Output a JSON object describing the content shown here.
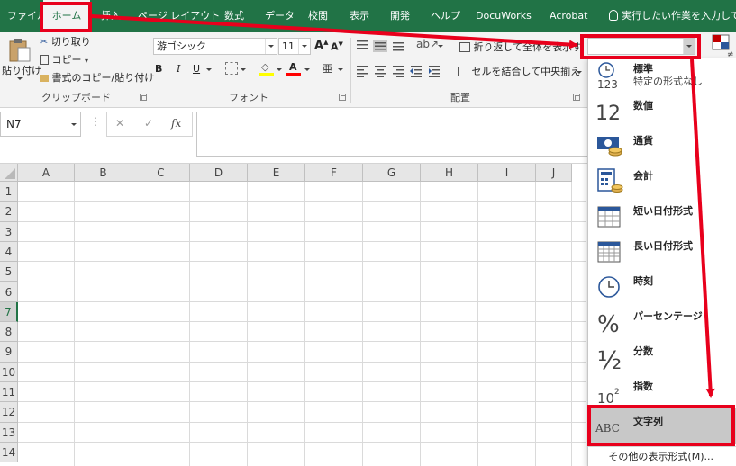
{
  "ribbon_tabs": [
    "ファイル",
    "ホーム",
    "挿入",
    "ページ レイアウト",
    "数式",
    "データ",
    "校閲",
    "表示",
    "開発",
    "ヘルプ",
    "DocuWorks",
    "Acrobat"
  ],
  "tell_me": "実行したい作業を入力してくだ",
  "clipboard": {
    "paste": "貼り付け",
    "cut": "切り取り",
    "copy": "コピー",
    "format_painter": "書式のコピー/貼り付け",
    "group_label": "クリップボード"
  },
  "font": {
    "name": "游ゴシック",
    "size": "11",
    "grow": "A",
    "shrink": "A",
    "bold": "B",
    "italic": "I",
    "underline": "U",
    "font_color_letter": "A",
    "group_label": "フォント"
  },
  "alignment": {
    "wrap_text": "折り返して全体を表示す",
    "merge_center": "セルを結合して中央揃え",
    "group_label": "配置"
  },
  "number": {
    "format_value": ""
  },
  "formula_bar": {
    "name_box": "N7",
    "cancel": "✕",
    "enter": "✓",
    "fx": "fx"
  },
  "grid": {
    "columns": [
      "A",
      "B",
      "C",
      "D",
      "E",
      "F",
      "G",
      "H",
      "I",
      "J"
    ],
    "rows": [
      "1",
      "2",
      "3",
      "4",
      "5",
      "6",
      "7",
      "8",
      "9",
      "10",
      "11",
      "12",
      "13",
      "14"
    ],
    "selected_row": "7"
  },
  "number_formats": [
    {
      "label": "標準",
      "sub": "特定の形式なし",
      "icon": "clock-123-icon"
    },
    {
      "label": "数値",
      "sub": "",
      "icon": "number-12-icon"
    },
    {
      "label": "通貨",
      "sub": "",
      "icon": "currency-icon"
    },
    {
      "label": "会計",
      "sub": "",
      "icon": "accounting-icon"
    },
    {
      "label": "短い日付形式",
      "sub": "",
      "icon": "calendar-short-icon"
    },
    {
      "label": "長い日付形式",
      "sub": "",
      "icon": "calendar-long-icon"
    },
    {
      "label": "時刻",
      "sub": "",
      "icon": "clock-icon"
    },
    {
      "label": "パーセンテージ",
      "sub": "",
      "icon": "percent-icon"
    },
    {
      "label": "分数",
      "sub": "",
      "icon": "fraction-icon"
    },
    {
      "label": "指数",
      "sub": "",
      "icon": "scientific-icon"
    },
    {
      "label": "文字列",
      "sub": "",
      "icon": "text-abc-icon",
      "selected": true
    }
  ],
  "icon_text": {
    "n123": "123",
    "n12": "12",
    "percent": "%",
    "half": "½",
    "ten": "10",
    "sup2": "2",
    "abc": "ABC"
  },
  "more_formats": "その他の表示形式(M)...",
  "colors": {
    "ribbon_green": "#217346",
    "annotation_red": "#e8001c",
    "selected_item": "#c8c8c8"
  }
}
